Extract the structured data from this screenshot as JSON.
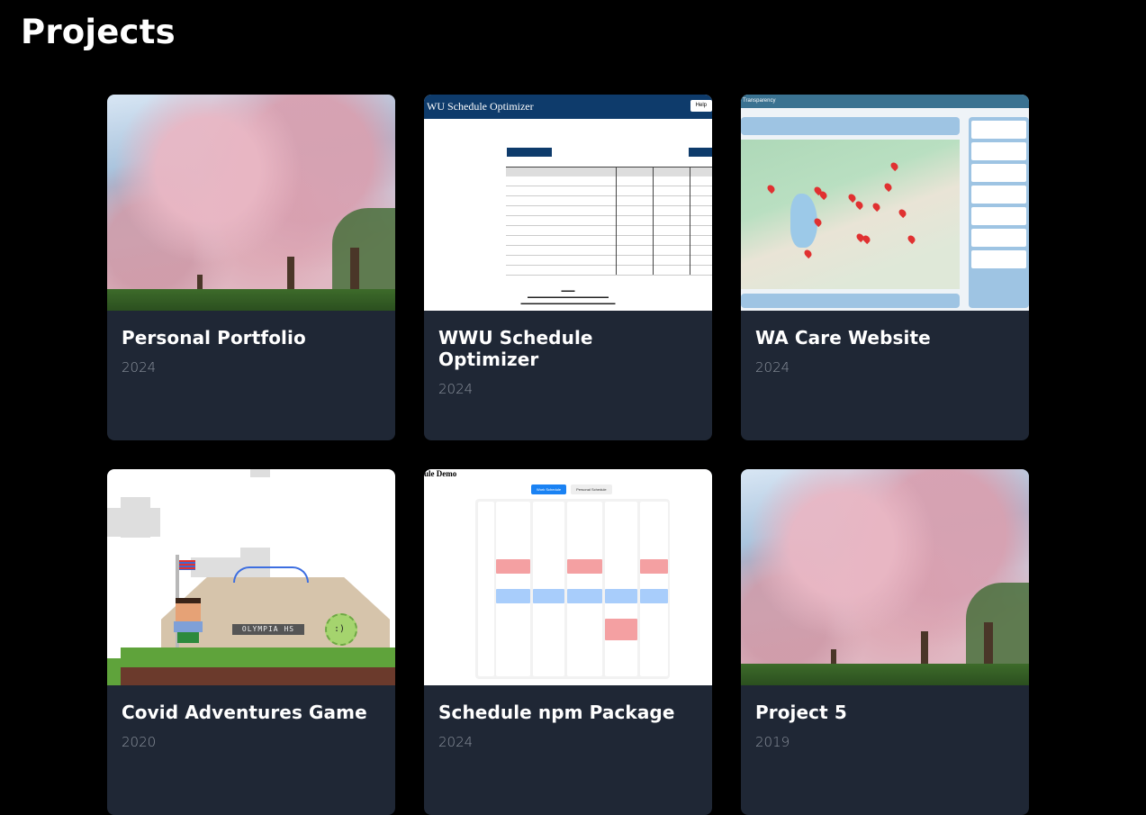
{
  "page": {
    "title": "Projects"
  },
  "colors": {
    "background": "#000000",
    "card_background": "#1f2735",
    "title_text": "#ffffff",
    "year_text": "#8a919c"
  },
  "projects": [
    {
      "title": "Personal Portfolio",
      "year": "2024",
      "thumbnail": "cherry-blossom-photo"
    },
    {
      "title": "WWU Schedule Optimizer",
      "year": "2024",
      "thumbnail": "schedule-optimizer-screenshot",
      "thumb_text": {
        "header": "WU Schedule Optimizer",
        "help": "Help"
      }
    },
    {
      "title": "WA Care Website",
      "year": "2024",
      "thumbnail": "map-screenshot",
      "thumb_text": {
        "header": "Transparency"
      }
    },
    {
      "title": "Covid Adventures Game",
      "year": "2020",
      "thumbnail": "pixel-art-game-screenshot",
      "thumb_text": {
        "sign": "OLYMPIA HS"
      }
    },
    {
      "title": "Schedule npm Package",
      "year": "2024",
      "thumbnail": "schedule-demo-screenshot",
      "thumb_text": {
        "header": "ule Demo",
        "tab_active": "Work Schedule",
        "tab_inactive": "Personal Schedule"
      }
    },
    {
      "title": "Project 5",
      "year": "2019",
      "thumbnail": "cherry-blossom-photo"
    }
  ]
}
